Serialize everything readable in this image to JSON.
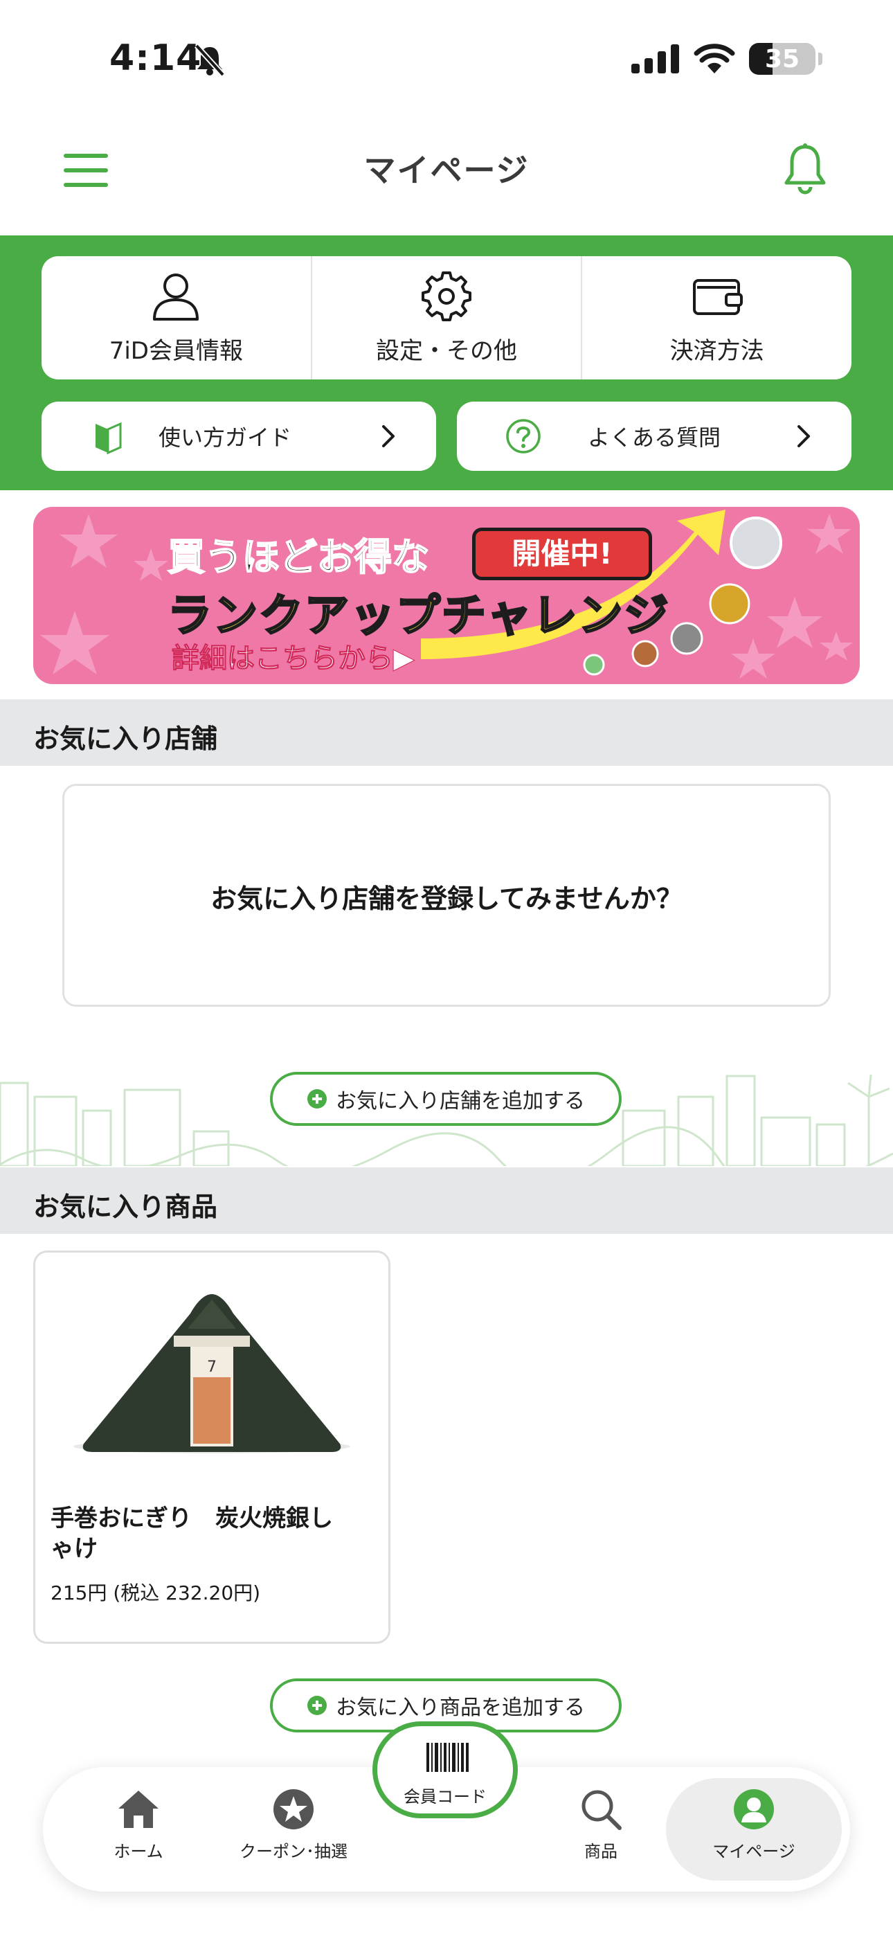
{
  "status_bar": {
    "time": "4:14",
    "battery": "35"
  },
  "header": {
    "title": "マイページ"
  },
  "quick_menu": {
    "member_info": "7iD会員情報",
    "settings": "設定・その他",
    "payment": "決済方法"
  },
  "guides": {
    "how_to": "使い方ガイド",
    "faq": "よくある質問"
  },
  "banner": {
    "line1": "買うほどお得な",
    "badge": "開催中!",
    "line2": "ランクアップチャレンジ",
    "line3": "詳細はこちらから▶"
  },
  "favorite_stores": {
    "heading": "お気に入り店舗",
    "empty_prompt": "お気に入り店舗を登録してみませんか？",
    "add_label": "お気に入り店舗を追加する"
  },
  "favorite_products": {
    "heading": "お気に入り商品",
    "items": [
      {
        "name": "手巻おにぎり　炭火焼銀しゃけ",
        "price": "215円 (税込 232.20円)"
      }
    ],
    "add_label": "お気に入り商品を追加する"
  },
  "bottom_nav": {
    "home": "ホーム",
    "coupon": "クーポン･抽選",
    "member_code": "会員コード",
    "products": "商品",
    "mypage": "マイページ"
  },
  "colors": {
    "accent": "#4aac45",
    "banner_bg": "#ef78a6",
    "section_bg": "#e6e7e9"
  }
}
